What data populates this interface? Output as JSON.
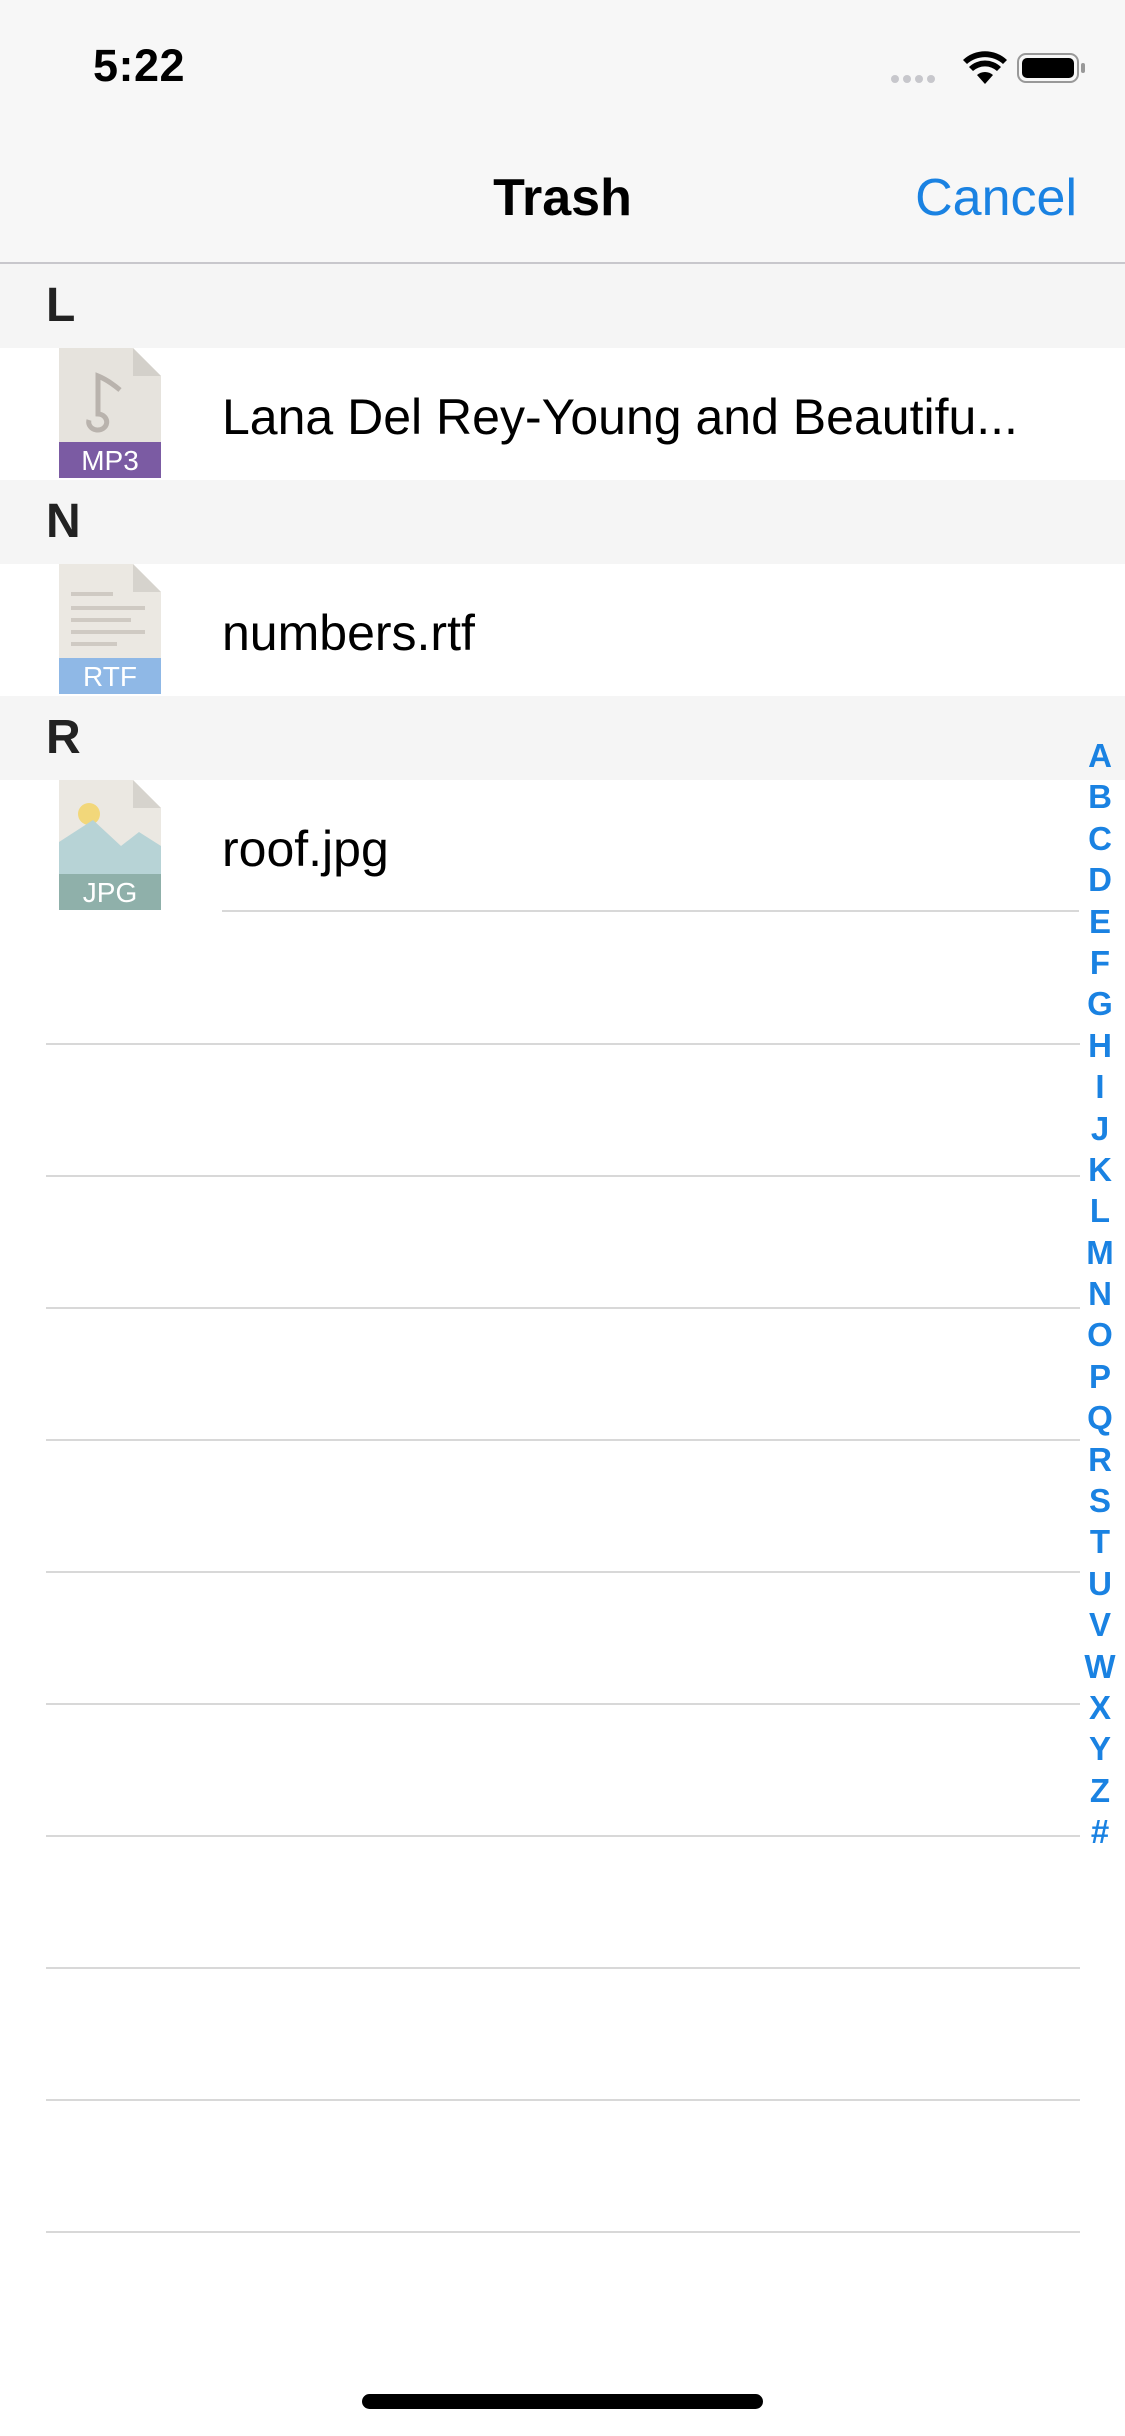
{
  "status_bar": {
    "time": "5:22"
  },
  "nav": {
    "title": "Trash",
    "cancel_label": "Cancel"
  },
  "sections": [
    {
      "letter": "L",
      "file": {
        "name": "Lana Del Rey-Young and Beautifu...",
        "type_label": "MP3",
        "icon": "mp3-file-icon"
      }
    },
    {
      "letter": "N",
      "file": {
        "name": "numbers.rtf",
        "type_label": "RTF",
        "icon": "rtf-file-icon"
      }
    },
    {
      "letter": "R",
      "file": {
        "name": "roof.jpg",
        "type_label": "JPG",
        "icon": "jpg-file-icon"
      }
    }
  ],
  "index_letters": [
    "A",
    "B",
    "C",
    "D",
    "E",
    "F",
    "G",
    "H",
    "I",
    "J",
    "K",
    "L",
    "M",
    "N",
    "O",
    "P",
    "Q",
    "R",
    "S",
    "T",
    "U",
    "V",
    "W",
    "X",
    "Y",
    "Z",
    "#"
  ],
  "colors": {
    "accent": "#1a82e2",
    "mp3_band": "#7b5ba3",
    "rtf_band": "#8fb8e6",
    "jpg_band": "#8fb0aa"
  }
}
